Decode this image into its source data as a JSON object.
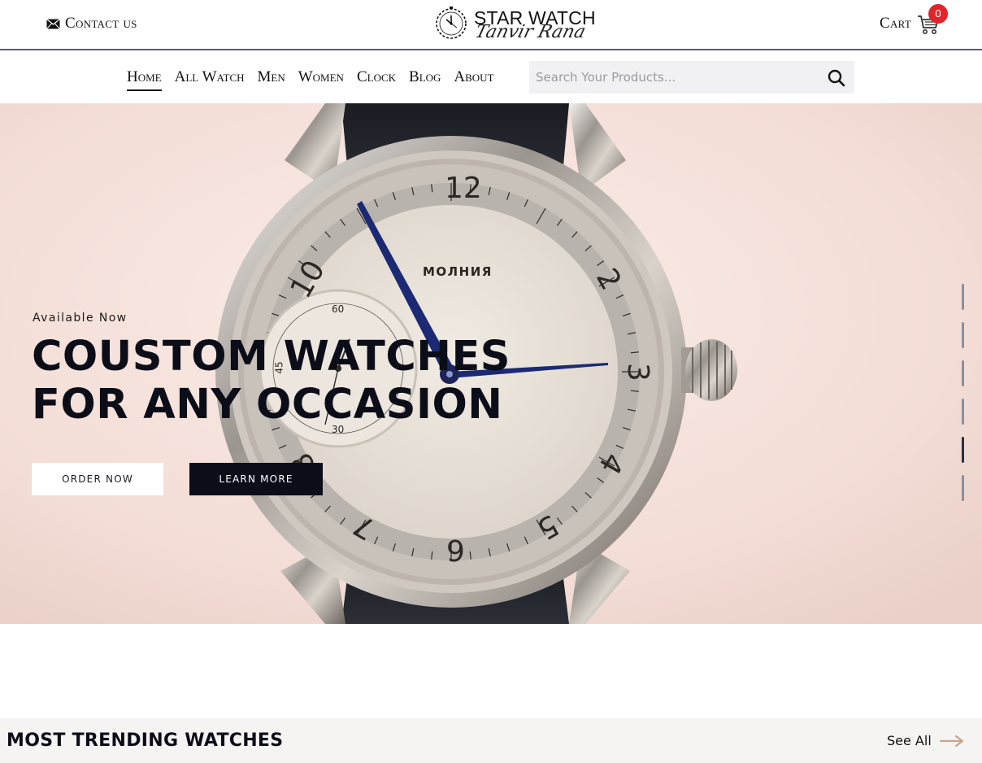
{
  "header": {
    "contact_label": "Contact us",
    "brand_name": "STAR WATCH",
    "brand_signature": "Tanvir Rana",
    "cart_label": "Cart",
    "cart_count": "0"
  },
  "nav": {
    "items": [
      {
        "label": "Home",
        "active": true
      },
      {
        "label": "All Watch",
        "active": false
      },
      {
        "label": "Men",
        "active": false
      },
      {
        "label": "Women",
        "active": false
      },
      {
        "label": "Clock",
        "active": false
      },
      {
        "label": "Blog",
        "active": false
      },
      {
        "label": "About",
        "active": false
      }
    ],
    "search_placeholder": "Search Your Products..."
  },
  "hero": {
    "eyebrow": "Available Now",
    "headline": "COUSTOM WATCHES FOR ANY OCCASION",
    "order_button": "ORDER NOW",
    "learn_button": "LEARN MORE",
    "dial_brand": "МОЛНИЯ",
    "dial_numerals": [
      "12",
      "2",
      "3",
      "4",
      "5",
      "6",
      "7",
      "8",
      "10"
    ],
    "subdial_numerals": [
      "60",
      "45",
      "30"
    ],
    "slides_total": 6,
    "active_slide": 5
  },
  "trending": {
    "title": "MOST TRENDING WATCHES",
    "see_all": "See All"
  },
  "colors": {
    "ink": "#0b0d18",
    "badge": "#e0252a",
    "hero_bg": "#f5e3dd",
    "arrow": "#c7a48c"
  },
  "icons": [
    "mail-icon",
    "clock-logo-icon",
    "cart-icon",
    "search-icon",
    "arrow-right-icon"
  ]
}
